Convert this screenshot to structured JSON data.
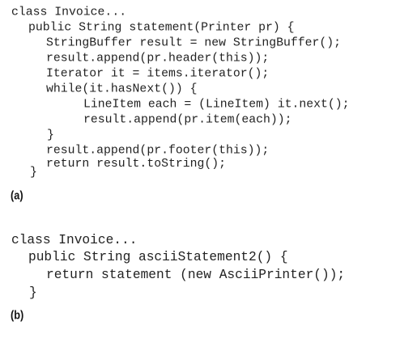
{
  "listing_a": {
    "lines": [
      "class Invoice...",
      "public String statement(Printer pr) {",
      "StringBuffer result = new StringBuffer();",
      "result.append(pr.header(this));",
      "Iterator it = items.iterator();",
      "while(it.hasNext()) {",
      "LineItem each = (LineItem) it.next();",
      "result.append(pr.item(each));",
      "}",
      "result.append(pr.footer(this));",
      "return result.toString();",
      "}"
    ],
    "label": "(a)"
  },
  "listing_b": {
    "lines": [
      "class Invoice...",
      "public String asciiStatement2() {",
      "return statement (new AsciiPrinter());",
      "}"
    ],
    "label": "(b)"
  }
}
